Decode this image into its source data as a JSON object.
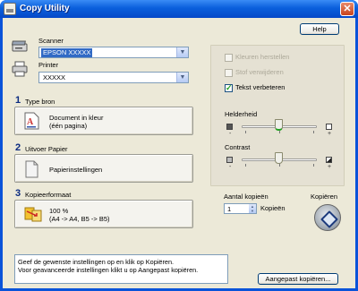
{
  "window": {
    "title": "Copy Utility",
    "close_symbol": "✕"
  },
  "header": {
    "help_label": "Help"
  },
  "scanner": {
    "label": "Scanner",
    "value": "EPSON XXXXX"
  },
  "printer": {
    "label": "Printer",
    "value": "XXXXX"
  },
  "sections": [
    {
      "number": "1",
      "title": "Type bron",
      "button_line1": "Document in kleur",
      "button_line2": "(één pagina)"
    },
    {
      "number": "2",
      "title": "Uitvoer Papier",
      "button_line1": "Papierinstellingen",
      "button_line2": ""
    },
    {
      "number": "3",
      "title": "Kopieerformaat",
      "button_line1": "100 %",
      "button_line2": "(A4 -> A4, B5 -> B5)"
    }
  ],
  "options": {
    "restore_colors": {
      "label": "Kleuren herstellen",
      "checked": false,
      "enabled": false
    },
    "remove_dust": {
      "label": "Stof verwijderen",
      "checked": false,
      "enabled": false
    },
    "enhance_text": {
      "label": "Tekst verbeteren",
      "checked": true,
      "enabled": true
    }
  },
  "brightness": {
    "label": "Helderheid",
    "minus": "-",
    "plus": "+",
    "level": 0.5
  },
  "contrast": {
    "label": "Contrast",
    "minus": "-",
    "plus": "+",
    "level": 0.5
  },
  "copies": {
    "label": "Aantal kopieën",
    "value": "1",
    "unit": "Kopieën"
  },
  "copy_action": {
    "label": "Kopiëren"
  },
  "info": {
    "line1": "Geef de gewenste instellingen op en klik op Kopiëren.",
    "line2": "Voor geavanceerde instellingen klikt u op Aangepast kopiëren."
  },
  "custom_copy": {
    "label": "Aangepast kopiëren..."
  },
  "colors": {
    "title_bar": "#0a5fdc",
    "client_bg": "#ece9d8",
    "selection": "#316ac5",
    "check": "#21a121"
  }
}
